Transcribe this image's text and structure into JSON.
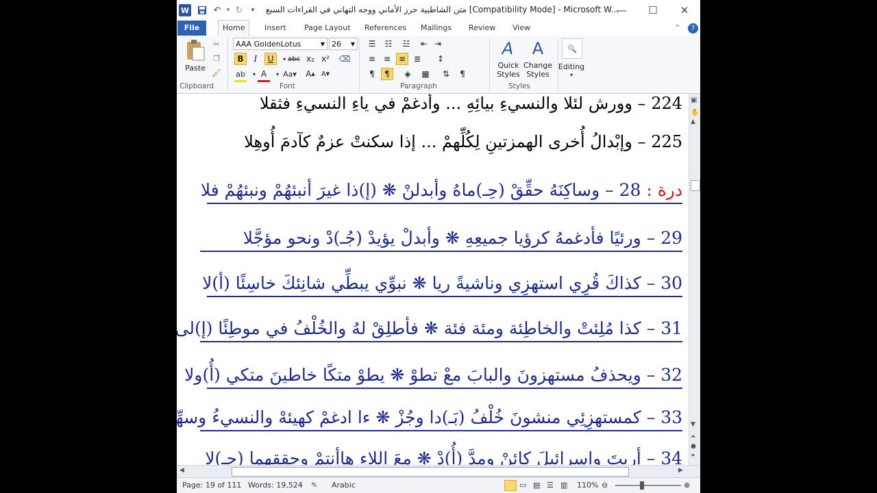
{
  "window": {
    "title": "متن الشاطبية حرز الأماني ووجه التهاني في القراءات السبع [Compatibility Mode] - Microsoft W...",
    "app_icon": "W"
  },
  "tabs": [
    "File",
    "Home",
    "Insert",
    "Page Layout",
    "References",
    "Mailings",
    "Review",
    "View"
  ],
  "ribbon": {
    "clipboard": {
      "paste_label": "Paste",
      "group_label": "Clipboard"
    },
    "font": {
      "font_name": "AAA GoldenLotus",
      "font_size": "26",
      "group_label": "Font",
      "bold": "B",
      "italic": "I",
      "underline": "U",
      "strike": "abc",
      "sub": "x₂",
      "sup": "x²"
    },
    "paragraph": {
      "group_label": "Paragraph"
    },
    "styles": {
      "quick_styles": "Quick Styles",
      "change_styles": "Change Styles",
      "group_label": "Styles"
    },
    "editing": {
      "label": "Editing"
    }
  },
  "document": {
    "lines": [
      {
        "num": "224",
        "text": "وورش لئلا والنسيءِ بيائِهِ ... وأدغمْ في ياءِ النسيءِ فثقلا"
      },
      {
        "num": "225",
        "text": "وإبْدالُ أُخرى الهمزتينِ لِكُلِّهمْ ... إذا سكنتْ عزمٌ كآدمَ أُوهِلا"
      },
      {
        "prefix": "درة :",
        "num": "28",
        "text": "وساكِنَهُ حقِّقْ (حِـ)ماهُ وأبدلنْ ❋ (إ)ذا غيرَ أنبئهُمْ ونبئهُمْ فلا"
      },
      {
        "num": "29",
        "text": "ورئيًا فأدغمهُ كرؤيا جميعِهِ ❋ وأبدلْ يؤيدْ (جُـ)دْ ونحو مؤجَّلا"
      },
      {
        "num": "30",
        "text": "كذاكَ قُرِي استهزِي وناشيةً ريا ❋ نبوِّي يبطِّي شانِئكَ خاسِئًا (أ)لا"
      },
      {
        "num": "31",
        "text": "كذا مُلِئتْ والخاطِئة ومئة فئة ❋ فأطلِقْ لهُ والخُلْفُ في موطِئًا (إ)لى"
      },
      {
        "num": "32",
        "text": "ويحذفُ مستهزونَ والبابَ معْ تطوْ ❋ يطوْ متكًا خاطينَ متكي (أُ)ولا"
      },
      {
        "num": "33",
        "text": "كمستهزِئِي منشونَ خُلْفُ (بَـ)دا وجُزْ ❋ ءا ادغمْ كهيئهْ والنسيءُ وسهِّلا"
      },
      {
        "num": "34",
        "text": "أريتَ وإسرائيلَ كائنْ ومدَّ (أُ)دْ ❋ معَ اللاءِ هاأنتمْ وحققهما (حِـ)لا"
      }
    ]
  },
  "status": {
    "page": "Page: 19 of 111",
    "words": "Words: 19,524",
    "language": "Arabic",
    "zoom": "110%"
  },
  "colors": {
    "verse_blue": "#1f2a8a",
    "red": "#d0161b",
    "word_blue": "#2b579a"
  }
}
